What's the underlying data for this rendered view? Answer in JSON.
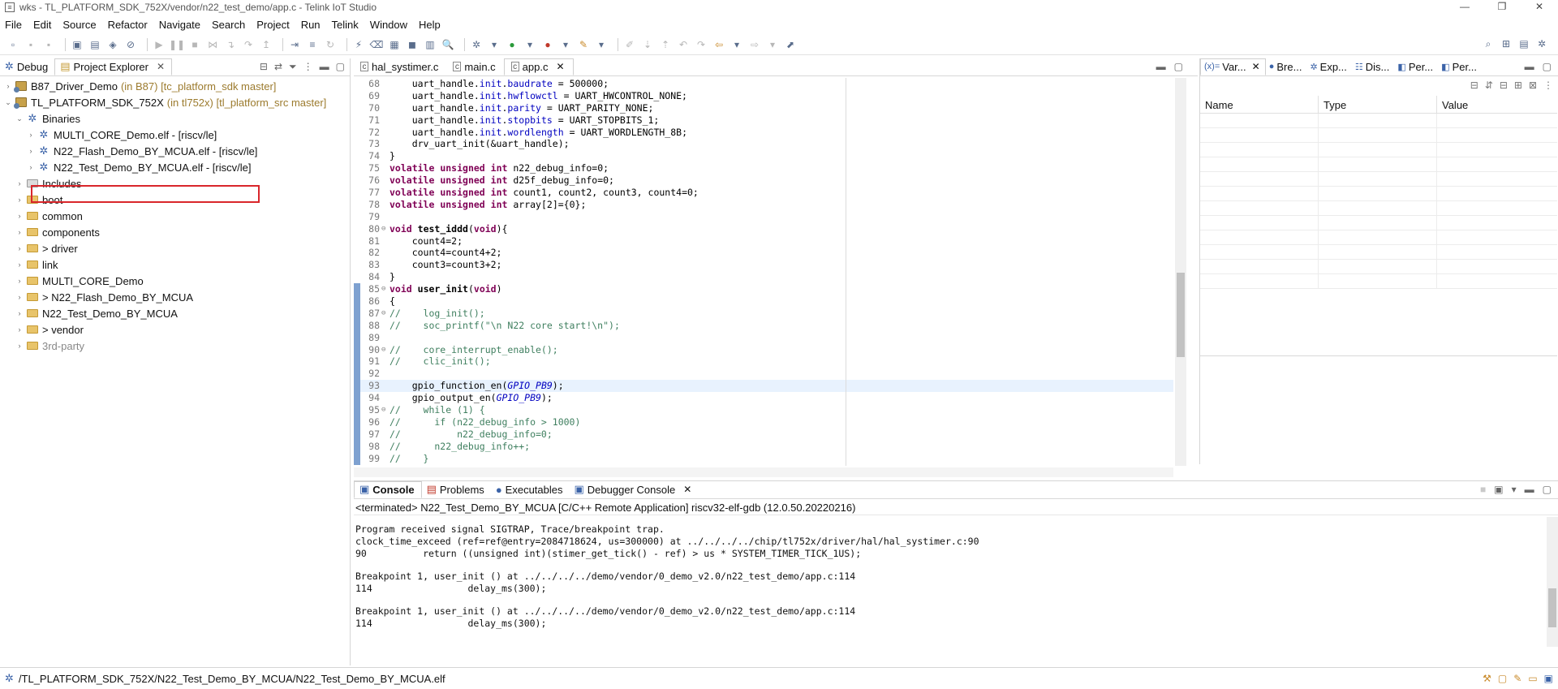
{
  "window": {
    "title": "wks - TL_PLATFORM_SDK_752X/vendor/n22_test_demo/app.c - Telink IoT Studio",
    "buttons": [
      "—",
      "❐",
      "✕"
    ]
  },
  "menu": [
    "File",
    "Edit",
    "Source",
    "Refactor",
    "Navigate",
    "Search",
    "Project",
    "Run",
    "Telink",
    "Window",
    "Help"
  ],
  "left_panel": {
    "tabs": [
      {
        "label": "Debug",
        "active": false
      },
      {
        "label": "Project Explorer",
        "active": true
      }
    ],
    "tree": [
      {
        "indent": 0,
        "arrow": "›",
        "icon": "project",
        "label": "B87_Driver_Demo",
        "suffix": "(in B87) [tc_platform_sdk master]"
      },
      {
        "indent": 0,
        "arrow": "⌄",
        "icon": "project",
        "label": "TL_PLATFORM_SDK_752X",
        "suffix": "(in tl752x) [tl_platform_src master]"
      },
      {
        "indent": 1,
        "arrow": "⌄",
        "icon": "binaries",
        "label": "Binaries",
        "suffix": ""
      },
      {
        "indent": 2,
        "arrow": "›",
        "icon": "binary",
        "label": "MULTI_CORE_Demo.elf - [riscv/le]",
        "suffix": ""
      },
      {
        "indent": 2,
        "arrow": "›",
        "icon": "binary",
        "label": "N22_Flash_Demo_BY_MCUA.elf - [riscv/le]",
        "suffix": ""
      },
      {
        "indent": 2,
        "arrow": "›",
        "icon": "binary",
        "label": "N22_Test_Demo_BY_MCUA.elf - [riscv/le]",
        "suffix": ""
      },
      {
        "indent": 1,
        "arrow": "›",
        "icon": "includes",
        "label": "Includes",
        "suffix": ""
      },
      {
        "indent": 1,
        "arrow": "›",
        "icon": "folder",
        "label": "boot",
        "suffix": ""
      },
      {
        "indent": 1,
        "arrow": "›",
        "icon": "folder",
        "label": "common",
        "suffix": ""
      },
      {
        "indent": 1,
        "arrow": "›",
        "icon": "folder",
        "label": "components",
        "suffix": ""
      },
      {
        "indent": 1,
        "arrow": "›",
        "icon": "folder",
        "label": "> driver",
        "suffix": ""
      },
      {
        "indent": 1,
        "arrow": "›",
        "icon": "folder",
        "label": "link",
        "suffix": ""
      },
      {
        "indent": 1,
        "arrow": "›",
        "icon": "folder",
        "label": "MULTI_CORE_Demo",
        "suffix": ""
      },
      {
        "indent": 1,
        "arrow": "›",
        "icon": "folder",
        "label": "> N22_Flash_Demo_BY_MCUA",
        "suffix": ""
      },
      {
        "indent": 1,
        "arrow": "›",
        "icon": "folder",
        "label": "N22_Test_Demo_BY_MCUA",
        "suffix": ""
      },
      {
        "indent": 1,
        "arrow": "›",
        "icon": "folder",
        "label": "> vendor",
        "suffix": ""
      },
      {
        "indent": 1,
        "arrow": "›",
        "icon": "folder",
        "label": "3rd-party",
        "suffix": "",
        "dim": true
      }
    ]
  },
  "editor": {
    "tabs": [
      {
        "label": "hal_systimer.c",
        "active": false
      },
      {
        "label": "main.c",
        "active": false
      },
      {
        "label": "app.c",
        "active": true
      }
    ],
    "lines": [
      {
        "n": "68",
        "fold": "",
        "bp": false,
        "hl": false,
        "html": "    uart_handle.<span class='fld'>init</span>.<span class='fld'>baudrate</span> = 500000;"
      },
      {
        "n": "69",
        "fold": "",
        "bp": false,
        "hl": false,
        "html": "    uart_handle.<span class='fld'>init</span>.<span class='fld'>hwflowctl</span> = UART_HWCONTROL_NONE;"
      },
      {
        "n": "70",
        "fold": "",
        "bp": false,
        "hl": false,
        "html": "    uart_handle.<span class='fld'>init</span>.<span class='fld'>parity</span> = UART_PARITY_NONE;"
      },
      {
        "n": "71",
        "fold": "",
        "bp": false,
        "hl": false,
        "html": "    uart_handle.<span class='fld'>init</span>.<span class='fld'>stopbits</span> = UART_STOPBITS_1;"
      },
      {
        "n": "72",
        "fold": "",
        "bp": false,
        "hl": false,
        "html": "    uart_handle.<span class='fld'>init</span>.<span class='fld'>wordlength</span> = UART_WORDLENGTH_8B;"
      },
      {
        "n": "73",
        "fold": "",
        "bp": false,
        "hl": false,
        "html": "    drv_uart_init(&amp;uart_handle);"
      },
      {
        "n": "74",
        "fold": "",
        "bp": false,
        "hl": false,
        "html": "}"
      },
      {
        "n": "75",
        "fold": "",
        "bp": false,
        "hl": false,
        "html": "<span class='kw'>volatile</span> <span class='kw'>unsigned</span> <span class='kw'>int</span> n22_debug_info=0;"
      },
      {
        "n": "76",
        "fold": "",
        "bp": false,
        "hl": false,
        "html": "<span class='kw'>volatile</span> <span class='kw'>unsigned</span> <span class='kw'>int</span> d25f_debug_info=0;"
      },
      {
        "n": "77",
        "fold": "",
        "bp": false,
        "hl": false,
        "html": "<span class='kw'>volatile</span> <span class='kw'>unsigned</span> <span class='kw'>int</span> count1, count2, count3, count4=0;"
      },
      {
        "n": "78",
        "fold": "",
        "bp": false,
        "hl": false,
        "html": "<span class='kw'>volatile</span> <span class='kw'>unsigned</span> <span class='kw'>int</span> array[2]={0};"
      },
      {
        "n": "79",
        "fold": "",
        "bp": false,
        "hl": false,
        "html": ""
      },
      {
        "n": "80",
        "fold": "⊖",
        "bp": false,
        "hl": false,
        "html": "<span class='kw'>void</span> <span class='fnb'>test_iddd</span>(<span class='kw'>void</span>){"
      },
      {
        "n": "81",
        "fold": "",
        "bp": false,
        "hl": false,
        "html": "    count4=2;"
      },
      {
        "n": "82",
        "fold": "",
        "bp": false,
        "hl": false,
        "html": "    count4=count4+2;"
      },
      {
        "n": "83",
        "fold": "",
        "bp": false,
        "hl": false,
        "html": "    count3=count3+2;"
      },
      {
        "n": "84",
        "fold": "",
        "bp": false,
        "hl": false,
        "html": "}"
      },
      {
        "n": "85",
        "fold": "⊖",
        "bp": true,
        "hl": false,
        "html": "<span class='kw'>void</span> <span class='fnb'>user_init</span>(<span class='kw'>void</span>)"
      },
      {
        "n": "86",
        "fold": "",
        "bp": true,
        "hl": false,
        "html": "{"
      },
      {
        "n": "87",
        "fold": "⊖",
        "bp": true,
        "hl": false,
        "html": "<span class='cm'>//    log_init();</span>"
      },
      {
        "n": "88",
        "fold": "",
        "bp": true,
        "hl": false,
        "html": "<span class='cm'>//    soc_printf(\"\\n N22 core start!\\n\");</span>"
      },
      {
        "n": "89",
        "fold": "",
        "bp": true,
        "hl": false,
        "html": ""
      },
      {
        "n": "90",
        "fold": "⊖",
        "bp": true,
        "hl": false,
        "html": "<span class='cm'>//    core_interrupt_enable();</span>"
      },
      {
        "n": "91",
        "fold": "",
        "bp": true,
        "hl": false,
        "html": "<span class='cm'>//    clic_init();</span>"
      },
      {
        "n": "92",
        "fold": "",
        "bp": true,
        "hl": false,
        "html": ""
      },
      {
        "n": "93",
        "fold": "",
        "bp": true,
        "hl": true,
        "html": "    gpio_function_en(<span class='it'>GPIO_PB9</span>);"
      },
      {
        "n": "94",
        "fold": "",
        "bp": true,
        "hl": false,
        "html": "    gpio_output_en(<span class='it'>GPIO_PB9</span>);"
      },
      {
        "n": "95",
        "fold": "⊖",
        "bp": true,
        "hl": false,
        "html": "<span class='cm'>//    while (1) {</span>"
      },
      {
        "n": "96",
        "fold": "",
        "bp": true,
        "hl": false,
        "html": "<span class='cm'>//      if (n22_debug_info &gt; 1000)</span>"
      },
      {
        "n": "97",
        "fold": "",
        "bp": true,
        "hl": false,
        "html": "<span class='cm'>//          n22_debug_info=0;</span>"
      },
      {
        "n": "98",
        "fold": "",
        "bp": true,
        "hl": false,
        "html": "<span class='cm'>//      n22_debug_info++;</span>"
      },
      {
        "n": "99",
        "fold": "",
        "bp": true,
        "hl": false,
        "html": "<span class='cm'>//    }</span>"
      }
    ]
  },
  "right_panel": {
    "tabs": [
      {
        "label": "Var...",
        "prefix": "(x)=",
        "active": true
      },
      {
        "label": "Bre...",
        "prefix": "●",
        "active": false
      },
      {
        "label": "Exp...",
        "prefix": "✲",
        "active": false
      },
      {
        "label": "Dis...",
        "prefix": "☷",
        "active": false
      },
      {
        "label": "Per...",
        "prefix": "◧",
        "active": false
      },
      {
        "label": "Per...",
        "prefix": "◧",
        "active": false
      }
    ],
    "columns": [
      "Name",
      "Type",
      "Value"
    ]
  },
  "console": {
    "tabs": [
      {
        "label": "Console",
        "active": true
      },
      {
        "label": "Problems",
        "active": false
      },
      {
        "label": "Executables",
        "active": false
      },
      {
        "label": "Debugger Console",
        "active": false
      }
    ],
    "description": "<terminated> N22_Test_Demo_BY_MCUA [C/C++ Remote Application] riscv32-elf-gdb (12.0.50.20220216)",
    "output": [
      "Program received signal SIGTRAP, Trace/breakpoint trap.",
      "clock_time_exceed (ref=ref@entry=2084718624, us=300000) at ../../../../chip/tl752x/driver/hal/hal_systimer.c:90",
      "90          return ((unsigned int)(stimer_get_tick() - ref) > us * SYSTEM_TIMER_TICK_1US);",
      "",
      "Breakpoint 1, user_init () at ../../../../demo/vendor/0_demo_v2.0/n22_test_demo/app.c:114",
      "114                 delay_ms(300);",
      "",
      "Breakpoint 1, user_init () at ../../../../demo/vendor/0_demo_v2.0/n22_test_demo/app.c:114",
      "114                 delay_ms(300);"
    ]
  },
  "status": {
    "path": "/TL_PLATFORM_SDK_752X/N22_Test_Demo_BY_MCUA/N22_Test_Demo_BY_MCUA.elf"
  },
  "colors": {
    "selection_box": "#d9262b",
    "breakpoint_gutter": "#7ea1d0",
    "keyword": "#7f0055",
    "comment": "#3f7f5f"
  }
}
